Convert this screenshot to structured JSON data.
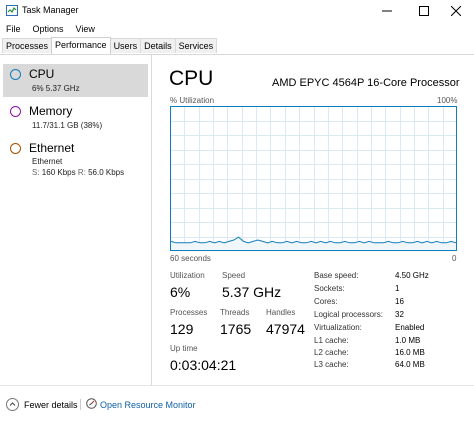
{
  "window": {
    "title": "Task Manager"
  },
  "menu": [
    "File",
    "Options",
    "View"
  ],
  "tabs": [
    "Processes",
    "Performance",
    "Users",
    "Details",
    "Services"
  ],
  "sidebar": {
    "items": [
      {
        "title": "CPU",
        "sub1": "6%  5.37 GHz",
        "color": "#117dbb"
      },
      {
        "title": "Memory",
        "sub1": "11.7/31.1 GB (38%)",
        "color": "#8b12ae"
      },
      {
        "title": "Ethernet",
        "sub1": "Ethernet",
        "sub2_s_label": "S:",
        "sub2_s_value": "160 Kbps",
        "sub2_r_label": "R:",
        "sub2_r_value": "56.0 Kbps",
        "color": "#a74f01"
      }
    ]
  },
  "main": {
    "title": "CPU",
    "processor": "AMD EPYC 4564P 16-Core Processor",
    "util_label": "% Utilization",
    "util_max": "100%",
    "time_label": "60 seconds",
    "time_min": "0",
    "utilization": {
      "label": "Utilization",
      "value": "6%"
    },
    "speed": {
      "label": "Speed",
      "value": "5.37 GHz"
    },
    "processes": {
      "label": "Processes",
      "value": "129"
    },
    "threads": {
      "label": "Threads",
      "value": "1765"
    },
    "handles": {
      "label": "Handles",
      "value": "47974"
    },
    "uptime": {
      "label": "Up time",
      "value": "0:03:04:21"
    },
    "details": [
      {
        "label": "Base speed:",
        "value": "4.50 GHz"
      },
      {
        "label": "Sockets:",
        "value": "1"
      },
      {
        "label": "Cores:",
        "value": "16"
      },
      {
        "label": "Logical processors:",
        "value": "32"
      },
      {
        "label": "Virtualization:",
        "value": "Enabled"
      },
      {
        "label": "L1 cache:",
        "value": "1.0 MB"
      },
      {
        "label": "L2 cache:",
        "value": "16.0 MB"
      },
      {
        "label": "L3 cache:",
        "value": "64.0 MB"
      }
    ]
  },
  "footer": {
    "fewer_details": "Fewer details",
    "open_monitor": "Open Resource Monitor"
  },
  "cpu_history": [
    6,
    5,
    5,
    5,
    5,
    6,
    5,
    5,
    6,
    5,
    6,
    5,
    6,
    7,
    9,
    6,
    5,
    6,
    7,
    6,
    5,
    6,
    5,
    5,
    6,
    5,
    6,
    5,
    5,
    6,
    5,
    6,
    5,
    6,
    5,
    5,
    6,
    5,
    5,
    6,
    5,
    6,
    5,
    5,
    5,
    6,
    5,
    5,
    6,
    5,
    5,
    6,
    5,
    6,
    5,
    6,
    5,
    5,
    6,
    5
  ],
  "colors": {
    "accent": "#117dbb",
    "graph_fill": "#f1f6fa",
    "grid": "#d9eaf4"
  }
}
